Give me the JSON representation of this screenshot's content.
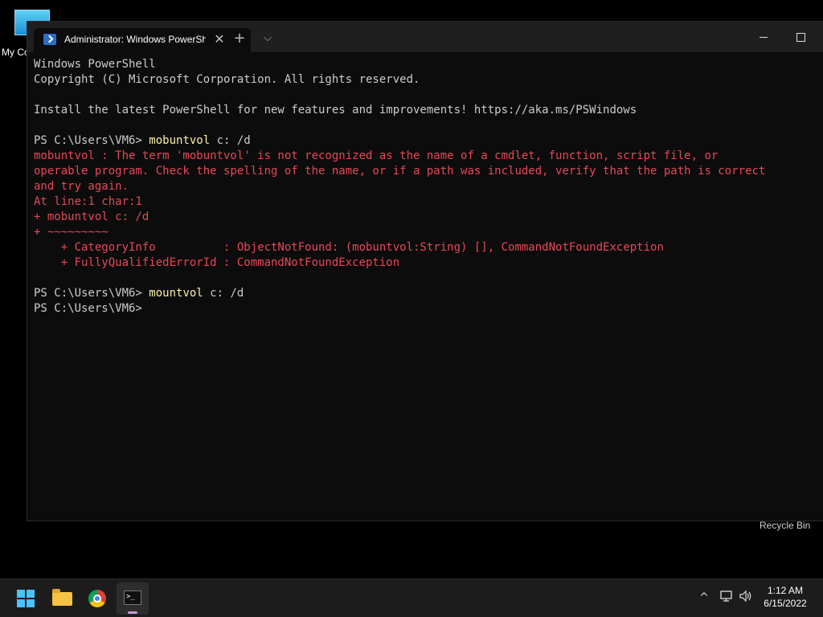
{
  "desktop": {
    "my_computer_label": "My Co",
    "recycle_bin_label": "Recycle Bin"
  },
  "window": {
    "tab_title": "Administrator: Windows PowerShell",
    "tab_close": "✕",
    "new_tab": "+",
    "dropdown": "⌵"
  },
  "console": {
    "lines": [
      {
        "text": "Windows PowerShell",
        "style": "normal"
      },
      {
        "text": "Copyright (C) Microsoft Corporation. All rights reserved.",
        "style": "normal"
      },
      {
        "text": "",
        "style": "normal"
      },
      {
        "text": "Install the latest PowerShell for new features and improvements! https://aka.ms/PSWindows",
        "style": "normal"
      },
      {
        "text": "",
        "style": "normal"
      },
      {
        "prompt": "PS C:\\Users\\VM6> ",
        "command": "mobuntvol",
        "args": " c: /d",
        "style": "prompt"
      },
      {
        "text": "mobuntvol : The term 'mobuntvol' is not recognized as the name of a cmdlet, function, script file, or",
        "style": "error"
      },
      {
        "text": "operable program. Check the spelling of the name, or if a path was included, verify that the path is correct",
        "style": "error"
      },
      {
        "text": "and try again.",
        "style": "error"
      },
      {
        "text": "At line:1 char:1",
        "style": "error"
      },
      {
        "text": "+ mobuntvol c: /d",
        "style": "error"
      },
      {
        "text": "+ ~~~~~~~~~",
        "style": "error"
      },
      {
        "text": "    + CategoryInfo          : ObjectNotFound: (mobuntvol:String) [], CommandNotFoundException",
        "style": "error"
      },
      {
        "text": "    + FullyQualifiedErrorId : CommandNotFoundException",
        "style": "error"
      },
      {
        "text": "",
        "style": "normal"
      },
      {
        "prompt": "PS C:\\Users\\VM6> ",
        "command": "mountvol",
        "args": " c: /d",
        "style": "prompt"
      },
      {
        "prompt": "PS C:\\Users\\VM6>",
        "command": "",
        "args": "",
        "style": "prompt"
      }
    ]
  },
  "taskbar": {
    "time": "1:12 AM",
    "date": "6/15/2022",
    "tray_chevron": "^",
    "volume_glyph": "🔊"
  },
  "colors": {
    "error": "#e74856",
    "command": "#f9f1a5",
    "text": "#cccccc",
    "background": "#0c0c0c",
    "accent": "#4cc2ff"
  }
}
